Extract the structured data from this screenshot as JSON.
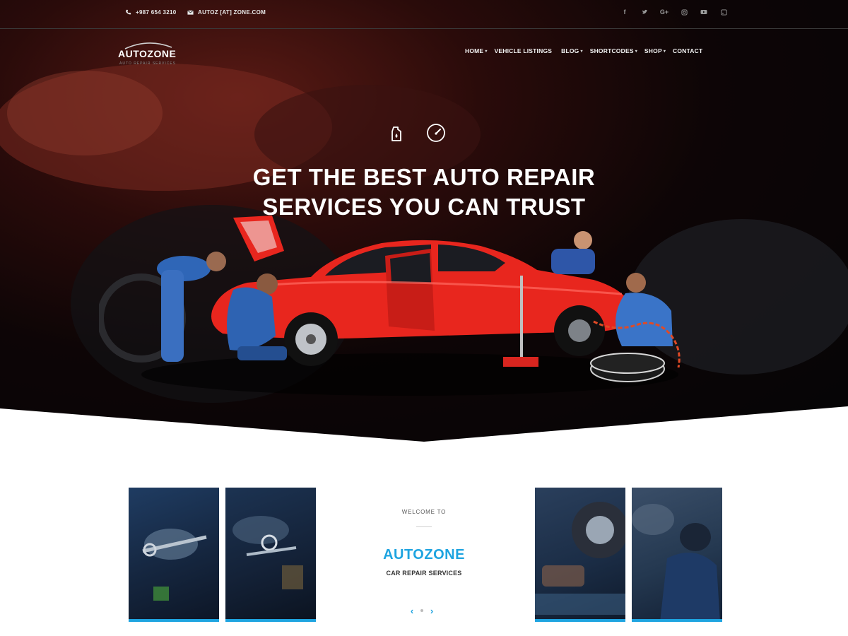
{
  "topbar": {
    "phone": "+987 654 3210",
    "email": "AUTOZ [AT] ZONE.COM",
    "social": [
      "facebook-icon",
      "twitter-icon",
      "google-plus-icon",
      "instagram-icon",
      "youtube-icon",
      "rss-icon"
    ]
  },
  "logo": {
    "text": "AUTOZONE",
    "subtitle": "AUTO REPAIR SERVICES"
  },
  "nav": {
    "items": [
      {
        "label": "HOME",
        "dropdown": true
      },
      {
        "label": "VEHICLE LISTINGS",
        "dropdown": false
      },
      {
        "label": "BLOG",
        "dropdown": true
      },
      {
        "label": "SHORTCODES",
        "dropdown": true
      },
      {
        "label": "SHOP",
        "dropdown": true
      },
      {
        "label": "CONTACT",
        "dropdown": false
      }
    ]
  },
  "hero": {
    "icons": [
      "oil-can-icon",
      "gauge-icon"
    ],
    "headline_line1": "GET THE BEST AUTO REPAIR",
    "headline_line2": "SERVICES YOU CAN TRUST"
  },
  "welcome": {
    "small": "WELCOME TO",
    "title": "AUTOZONE",
    "subtitle": "CAR REPAIR SERVICES"
  },
  "colors": {
    "accent": "#1ea4e0",
    "car": "#e8261e",
    "hero_bg": "#050506"
  }
}
